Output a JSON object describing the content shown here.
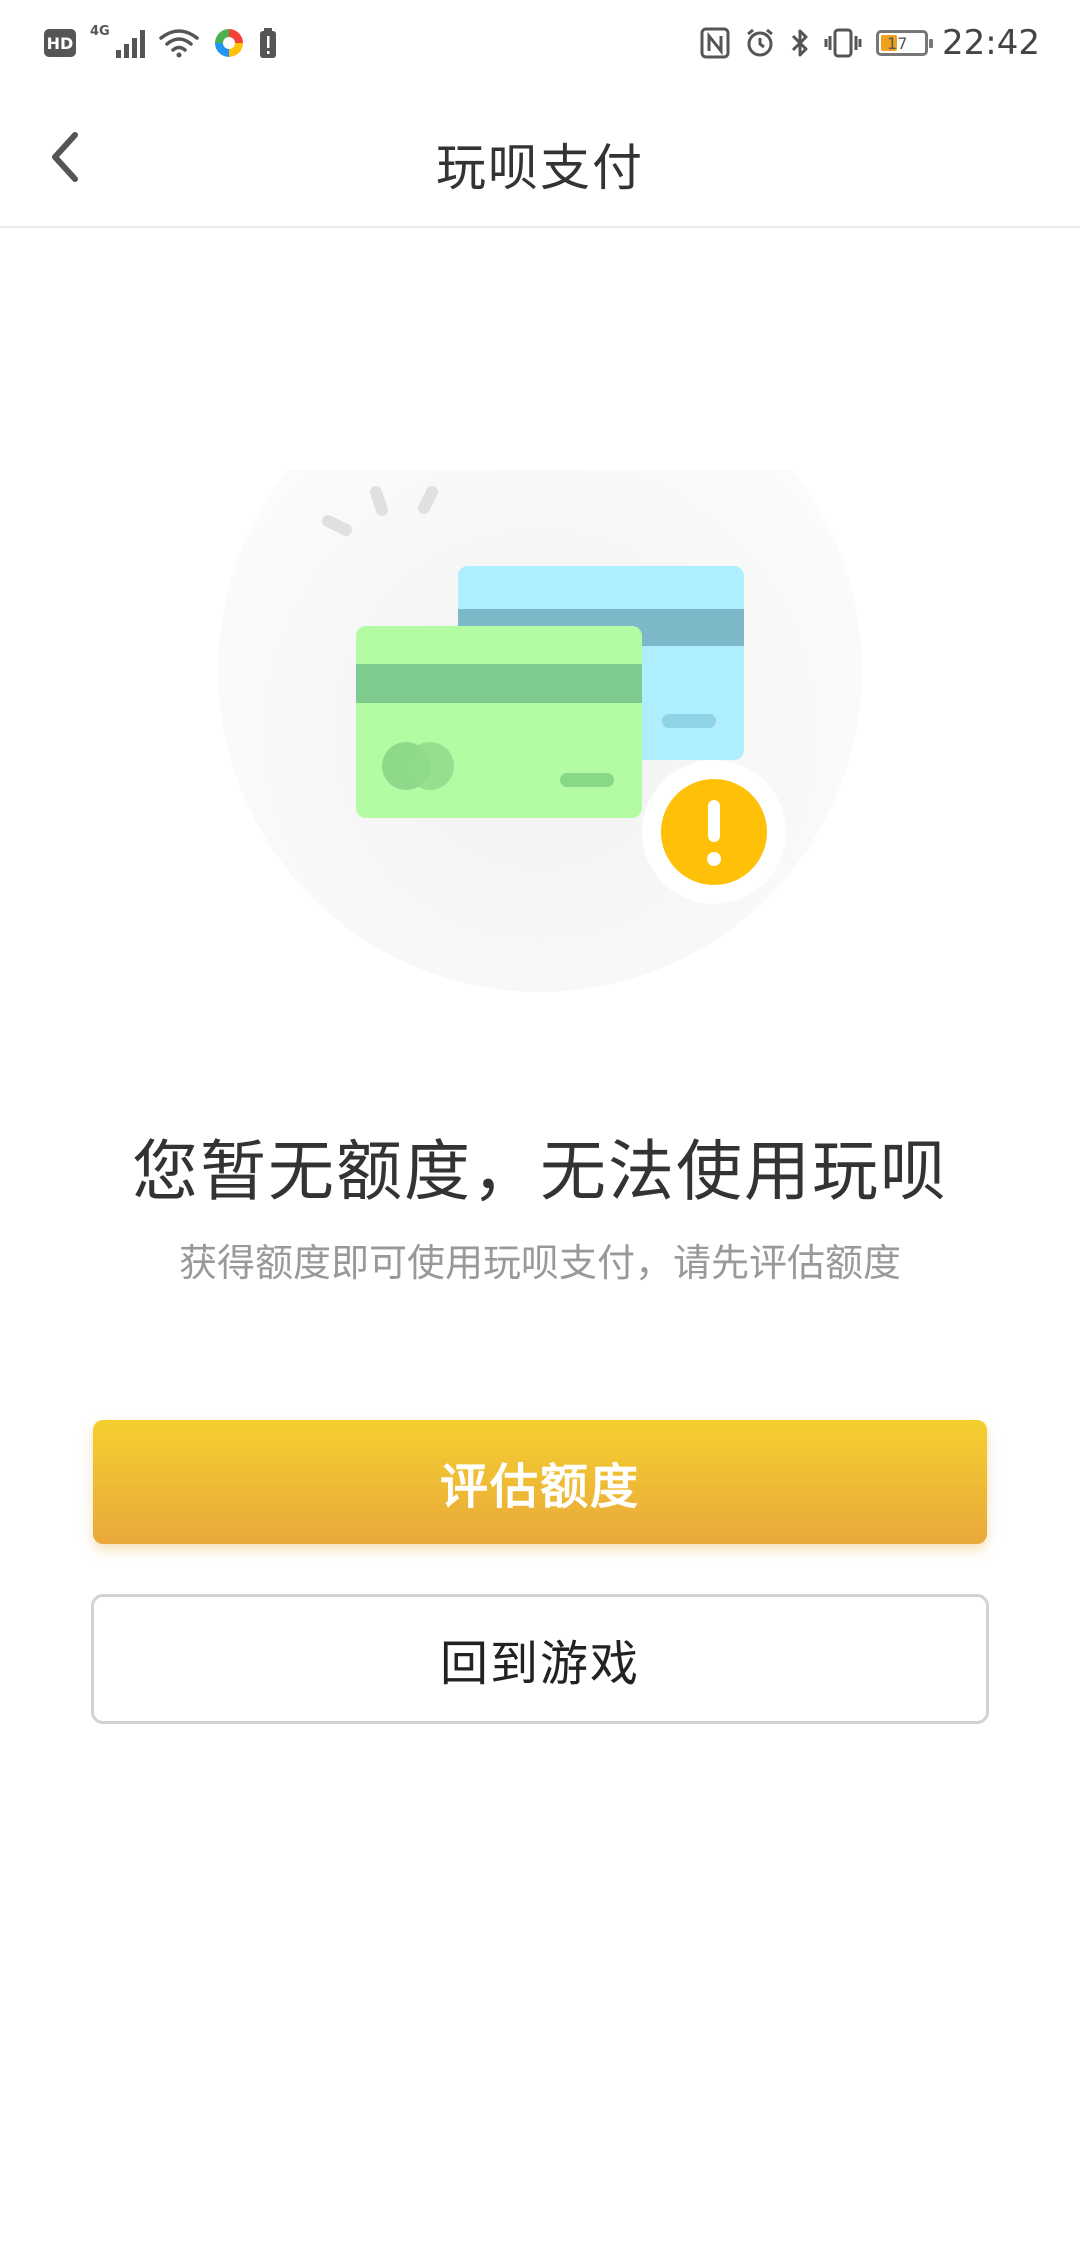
{
  "status_bar": {
    "hd_label": "HD",
    "network_label": "4G",
    "battery_level": "17",
    "time": "22:42"
  },
  "nav": {
    "title": "玩呗支付",
    "back_icon": "chevron-left-icon"
  },
  "content": {
    "illustration": "credit-cards-warning",
    "main_message": "您暂无额度，无法使用玩呗",
    "sub_message": "获得额度即可使用玩呗支付，请先评估额度"
  },
  "actions": {
    "primary_label": "评估额度",
    "secondary_label": "回到游戏"
  },
  "colors": {
    "accent_top": "#f5cf2f",
    "accent_bottom": "#e9a93b",
    "warning": "#ffc107",
    "card_green": "#b3fca4",
    "card_blue": "#aeeeff"
  }
}
